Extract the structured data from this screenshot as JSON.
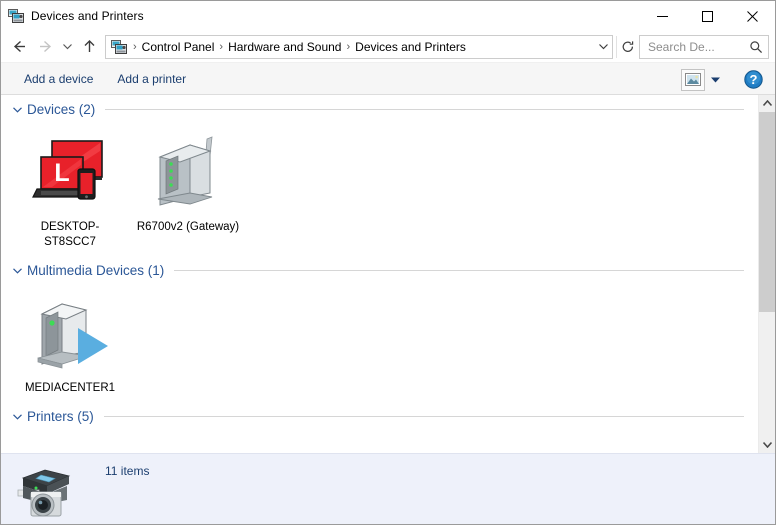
{
  "window": {
    "title": "Devices and Printers",
    "title_icon": "devices-and-printers-icon",
    "minimize_label": "—",
    "maximize_label": "□",
    "close_label": "✕"
  },
  "nav": {
    "back_icon": "back-arrow-icon",
    "forward_icon": "forward-arrow-icon",
    "recent_icon": "chevron-down-icon",
    "up_icon": "up-arrow-icon",
    "address_icon": "devices-and-printers-icon",
    "breadcrumbs": [
      {
        "label": "Control Panel"
      },
      {
        "label": "Hardware and Sound"
      },
      {
        "label": "Devices and Printers"
      }
    ],
    "separator": "›",
    "dropdown_icon": "chevron-down-icon",
    "refresh_icon": "refresh-icon"
  },
  "search": {
    "placeholder": "Search De...",
    "icon": "search-icon"
  },
  "toolbar": {
    "add_device_label": "Add a device",
    "add_printer_label": "Add a printer",
    "view_icon": "view-options-icon",
    "view_dropdown_icon": "chevron-down-icon",
    "help_icon": "help-icon",
    "help_label": "?"
  },
  "groups": [
    {
      "title": "Devices (2)",
      "chevron": "chevron-down-icon",
      "items": [
        {
          "label": "DESKTOP-ST8SCC7",
          "icon": "this-pc-icon"
        },
        {
          "label": "R6700v2 (Gateway)",
          "icon": "router-gateway-icon"
        }
      ]
    },
    {
      "title": "Multimedia Devices (1)",
      "chevron": "chevron-down-icon",
      "items": [
        {
          "label": "MEDIACENTER1",
          "icon": "media-server-icon"
        }
      ]
    },
    {
      "title": "Printers (5)",
      "chevron": "chevron-down-icon",
      "items": []
    }
  ],
  "scrollbar": {
    "up_icon": "scroll-up-icon",
    "down_icon": "scroll-down-icon"
  },
  "details": {
    "icon": "printer-scanner-camera-icon",
    "status": "11 items"
  },
  "colors": {
    "accent_blue": "#2b5797",
    "link_blue": "#1b3e6f",
    "details_bg": "#eef1fa",
    "device_red": "#e8212a",
    "led_green": "#3ddc55",
    "play_blue": "#5aaee0"
  }
}
